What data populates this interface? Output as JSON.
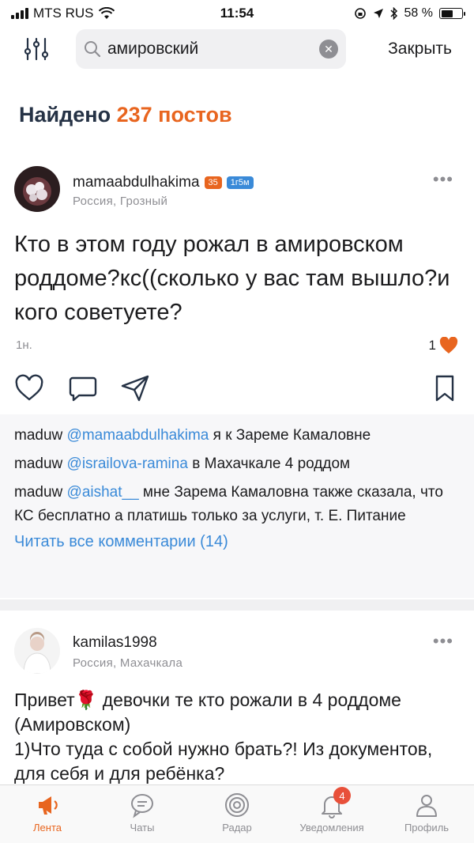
{
  "status_bar": {
    "carrier": "MTS RUS",
    "time": "11:54",
    "battery": "58 %",
    "battery_level": 0.58
  },
  "search": {
    "query": "амировский",
    "close_label": "Закрыть"
  },
  "results": {
    "prefix": "Найдено",
    "count": "237 постов"
  },
  "posts": [
    {
      "author": "mamaabdulhakima",
      "badge_age": "35",
      "badge_kid": "1г5м",
      "location": "Россия, Грозный",
      "text": "Кто в этом году рожал в амировском роддоме?кс((сколько у вас там вышло?и кого советуете?",
      "timestamp": "1н.",
      "likes": "1",
      "comments": [
        {
          "user": "maduw",
          "mention": "@mamaabdulhakima",
          "text": " я к Зареме Камаловне"
        },
        {
          "user": "maduw",
          "mention": "@israilova-ramina",
          "text": " в Махачкале 4 роддом"
        },
        {
          "user": "maduw",
          "mention": "@aishat__",
          "text": " мне Зарема Камаловна также сказала, что КС бесплатно а платишь только за услуги, т. Е. Питание"
        }
      ],
      "read_all": "Читать все комментарии (14)"
    },
    {
      "author": "kamilas1998",
      "location": "Россия, Махачкала",
      "text_line1": "Привет🌹 девочки те кто рожали в 4 роддоме (Амировском)",
      "text_line2": "1)Что туда с собой нужно брать?! Из документов, для себя и для ребёнка?"
    }
  ],
  "tabs": [
    {
      "label": "Лента",
      "icon": "megaphone-icon",
      "active": true
    },
    {
      "label": "Чаты",
      "icon": "chat-bubble-icon"
    },
    {
      "label": "Радар",
      "icon": "radar-icon"
    },
    {
      "label": "Уведомления",
      "icon": "bell-icon",
      "badge": "4"
    },
    {
      "label": "Профиль",
      "icon": "person-icon"
    }
  ],
  "colors": {
    "accent": "#e8651f",
    "link": "#3a8ad8",
    "title": "#253245"
  }
}
